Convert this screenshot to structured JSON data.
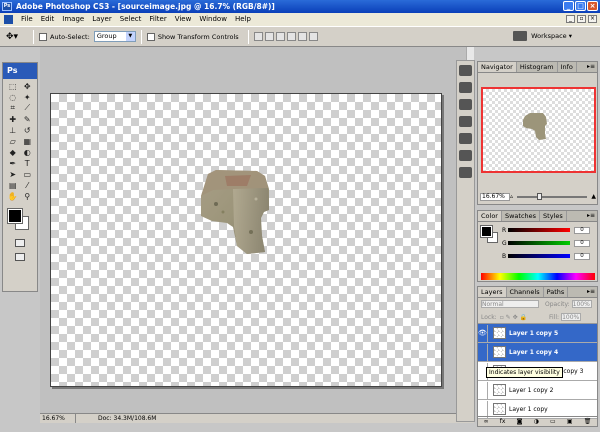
{
  "window": {
    "title": "Adobe Photoshop CS3 - [sourceimage.jpg @ 16.7% (RGB/8#)]",
    "app_icon": "Ps"
  },
  "menubar": {
    "items": [
      "File",
      "Edit",
      "Image",
      "Layer",
      "Select",
      "Filter",
      "View",
      "Window",
      "Help"
    ]
  },
  "options": {
    "auto_select_label": "Auto-Select:",
    "auto_select_value": "Group",
    "show_transform_label": "Show Transform Controls",
    "workspace_label": "Workspace ▾"
  },
  "toolbox": {
    "logo": "Ps"
  },
  "document": {
    "zoom": "16.67%",
    "doc_info": "Doc: 34.3M/108.6M"
  },
  "navigator": {
    "tabs": [
      "Navigator",
      "Histogram",
      "Info"
    ],
    "zoom": "16.67%"
  },
  "color_panel": {
    "tabs": [
      "Color",
      "Swatches",
      "Styles"
    ],
    "channels": [
      {
        "label": "R",
        "value": "0"
      },
      {
        "label": "G",
        "value": "0"
      },
      {
        "label": "B",
        "value": "0"
      }
    ]
  },
  "layers_panel": {
    "tabs": [
      "Layers",
      "Channels",
      "Paths"
    ],
    "blend_mode": "Normal",
    "opacity_label": "Opacity:",
    "opacity_value": "100%",
    "lock_label": "Lock:",
    "fill_label": "Fill:",
    "fill_value": "100%",
    "layers": [
      {
        "name": "Layer 1 copy 5",
        "selected": true,
        "visible": true
      },
      {
        "name": "Layer 1 copy 4",
        "selected": true,
        "visible": false
      },
      {
        "name": "Layer 1 copy 3",
        "selected": false,
        "visible": false
      },
      {
        "name": "Layer 1 copy 2",
        "selected": false,
        "visible": false
      },
      {
        "name": "Layer 1 copy",
        "selected": false,
        "visible": false
      }
    ]
  },
  "tooltip": "Indicates layer visibility"
}
